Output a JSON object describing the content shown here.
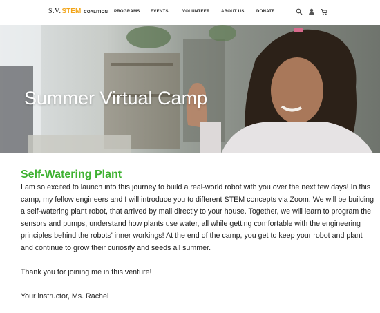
{
  "logo": {
    "prefix": "S.V.",
    "stem": "STEM",
    "suffix": "COALITION",
    "stem_color": "#f2a51a"
  },
  "nav": {
    "items": [
      "PROGRAMS",
      "EVENTS",
      "VOLUNTEER",
      "ABOUT US",
      "DONATE"
    ]
  },
  "icons": {
    "search": "search-icon",
    "account": "user-icon",
    "cart": "cart-icon"
  },
  "hero": {
    "title": "Summer Virtual Camp"
  },
  "main": {
    "heading": "Self-Watering Plant",
    "heading_color": "#3fb232",
    "paragraph": "I am so excited to launch into this journey to build a real-world robot with you over the next few days! In this camp, my fellow engineers and I will introduce you to different STEM concepts via Zoom. We will be building a self-watering plant robot, that arrived by mail directly to your house. Together, we will learn to program the sensors and pumps, understand how plants use water, all while getting comfortable with the engineering principles behind the robots' inner workings! At the end of the camp, you get to keep your robot and plant and continue to grow their curiosity and seeds all summer.",
    "thanks": "Thank you for joining me in this venture!",
    "signoff": "Your instructor, Ms. Rachel"
  }
}
